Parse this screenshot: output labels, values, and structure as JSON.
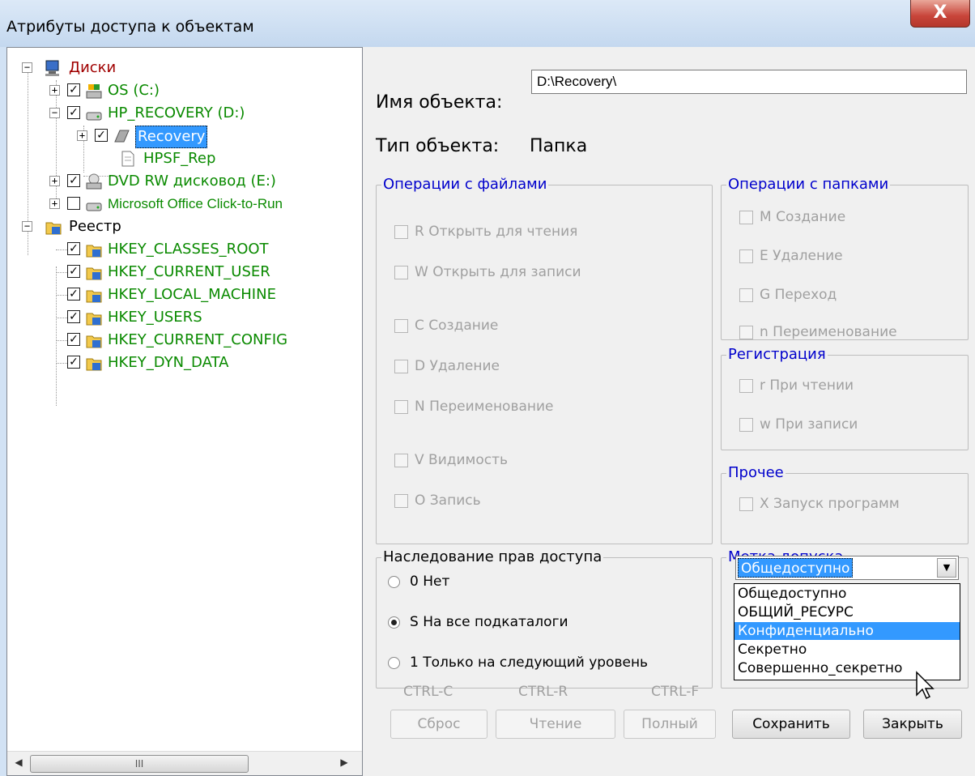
{
  "window": {
    "title": "Атрибуты доступа к объектам",
    "close_label": "X"
  },
  "tree": {
    "root_disks": "Диски",
    "drive_c": "OS (C:)",
    "drive_d": "HP_RECOVERY (D:)",
    "folder_recovery": "Recovery",
    "file_hpsf": "HPSF_Rep",
    "drive_e": "DVD RW дисковод (E:)",
    "office": "Microsoft Office Click-to-Run",
    "root_registry": "Реестр",
    "reg_keys": [
      "HKEY_CLASSES_ROOT",
      "HKEY_CURRENT_USER",
      "HKEY_LOCAL_MACHINE",
      "HKEY_USERS",
      "HKEY_CURRENT_CONFIG",
      "HKEY_DYN_DATA"
    ],
    "scroll_thumb": "III"
  },
  "object": {
    "name_label": "Имя объекта:",
    "name_value": "D:\\Recovery\\",
    "type_label": "Тип объекта:",
    "type_value": "Папка"
  },
  "file_ops": {
    "title": "Операции с файлами",
    "items": [
      "R Открыть для чтения",
      "W Открыть для записи",
      "C Создание",
      "D Удаление",
      "N Переименование",
      "V Видимость",
      "O Запись"
    ]
  },
  "folder_ops": {
    "title": "Операции с папками",
    "items": [
      "M Создание",
      "E Удаление",
      "G Переход",
      "n Переименование"
    ]
  },
  "registration": {
    "title": "Регистрация",
    "items": [
      "r При чтении",
      "w При записи"
    ]
  },
  "other": {
    "title": "Прочее",
    "items": [
      "X Запуск программ"
    ]
  },
  "inheritance": {
    "title": "Наследование прав доступа",
    "options": [
      "0 Нет",
      "S На все подкаталоги",
      "1 Только на следующий уровень"
    ],
    "selected": 1
  },
  "clearance": {
    "title": "Метка допуска",
    "selected": "Общедоступно",
    "options": [
      "Общедоступно",
      "ОБЩИЙ_РЕСУРС",
      "Конфиденциально",
      "Секретно",
      "Совершенно_секретно"
    ],
    "highlighted": 2
  },
  "shortcuts": [
    "CTRL-C",
    "CTRL-R",
    "CTRL-F"
  ],
  "buttons": {
    "reset": "Сброс",
    "read": "Чтение",
    "full": "Полный",
    "save": "Сохранить",
    "close": "Закрыть"
  },
  "colors": {
    "selection": "#3399ff",
    "group_title": "#0000cc",
    "tree_green": "#0a8a00",
    "tree_red": "#a00000"
  }
}
